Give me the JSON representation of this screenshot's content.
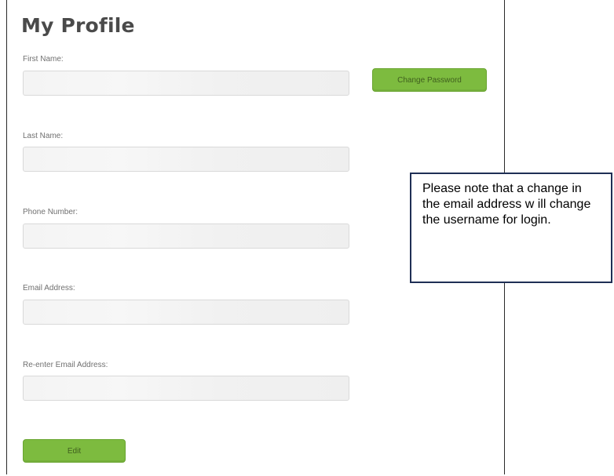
{
  "page": {
    "title": "My Profile"
  },
  "form": {
    "first_name_label": "First Name:",
    "last_name_label": "Last Name:",
    "phone_label": "Phone Number:",
    "email_label": "Email Address:",
    "reenter_email_label": "Re-enter Email Address:",
    "first_name_value": "",
    "last_name_value": "",
    "phone_value": "",
    "email_value": "",
    "reenter_email_value": ""
  },
  "buttons": {
    "change_password_label": "Change Password",
    "edit_label": "Edit"
  },
  "note": {
    "text": "Please note that a change in the email address w ill change the username for login."
  },
  "colors": {
    "button_green": "#7dbb3f",
    "note_border": "#1f2f55"
  }
}
